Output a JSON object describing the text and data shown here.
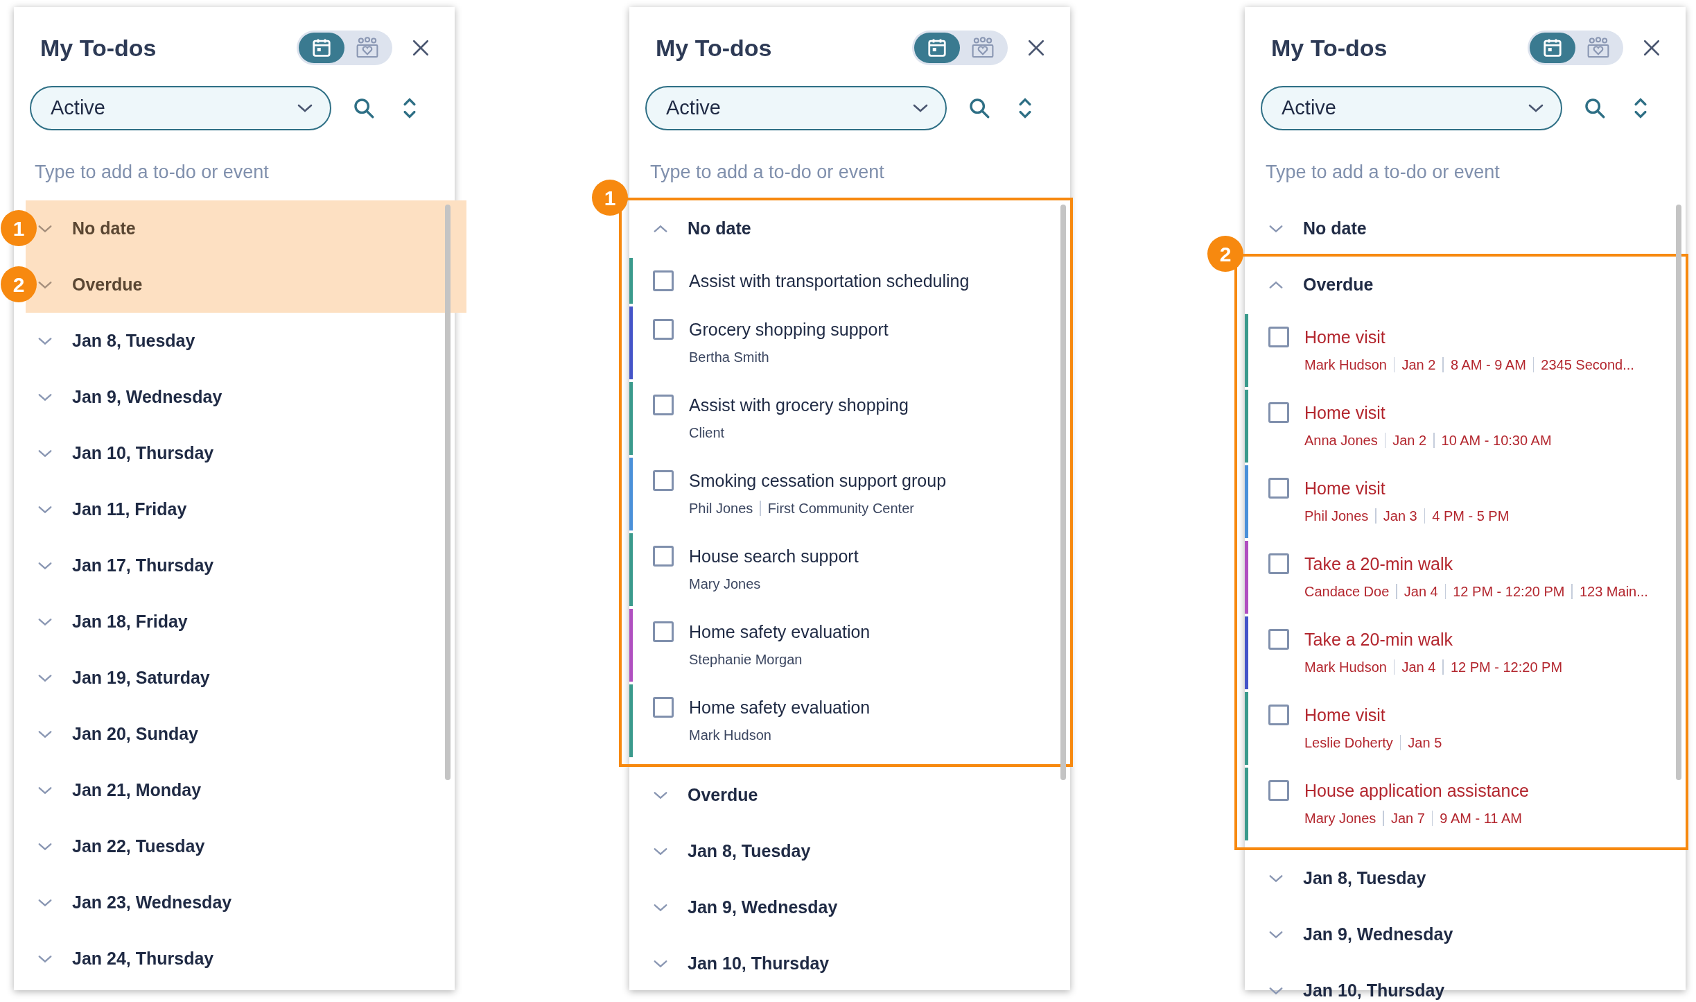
{
  "panels": [
    {
      "title": "My To-dos",
      "view_toggle": [
        {
          "kind": "calendar",
          "selected": true
        },
        {
          "kind": "people",
          "selected": false
        }
      ],
      "filter": "Active",
      "placeholder": "Type to add a to-do or event",
      "sections": [
        {
          "label": "No date",
          "expanded": false,
          "callout": {
            "kind": "fill",
            "badge": "1"
          }
        },
        {
          "label": "Overdue",
          "expanded": false,
          "callout": {
            "kind": "fill",
            "badge": "2"
          }
        },
        {
          "label": "Jan 8, Tuesday",
          "expanded": false
        },
        {
          "label": "Jan 9, Wednesday",
          "expanded": false
        },
        {
          "label": "Jan 10, Thursday",
          "expanded": false
        },
        {
          "label": "Jan 11, Friday",
          "expanded": false
        },
        {
          "label": "Jan 17, Thursday",
          "expanded": false
        },
        {
          "label": "Jan 18, Friday",
          "expanded": false
        },
        {
          "label": "Jan 19, Saturday",
          "expanded": false
        },
        {
          "label": "Jan 20, Sunday",
          "expanded": false
        },
        {
          "label": "Jan 21, Monday",
          "expanded": false
        },
        {
          "label": "Jan 22, Tuesday",
          "expanded": false
        },
        {
          "label": "Jan 23, Wednesday",
          "expanded": false
        },
        {
          "label": "Jan 24, Thursday",
          "expanded": false
        }
      ]
    },
    {
      "title": "My To-dos",
      "view_toggle": [
        {
          "kind": "calendar",
          "selected": true
        },
        {
          "kind": "people",
          "selected": false
        }
      ],
      "filter": "Active",
      "placeholder": "Type to add a to-do or event",
      "sections": [
        {
          "label": "No date",
          "expanded": true,
          "callout": {
            "kind": "outline",
            "badge": "1"
          },
          "items": [
            {
              "title": "Assist with transportation scheduling",
              "checked": false,
              "overdue": false,
              "color": "#3a9a8c"
            },
            {
              "title": "Grocery shopping support",
              "details": [
                "Bertha Smith"
              ],
              "checked": false,
              "overdue": false,
              "color": "#4454c8"
            },
            {
              "title": "Assist with grocery shopping",
              "details": [
                "Client"
              ],
              "checked": false,
              "overdue": false,
              "color": "#3a9a8c"
            },
            {
              "title": "Smoking cessation support group",
              "details": [
                "Phil Jones",
                "First Community Center"
              ],
              "checked": false,
              "overdue": false,
              "color": "#4a90d9"
            },
            {
              "title": "House search support",
              "details": [
                "Mary Jones"
              ],
              "checked": false,
              "overdue": false,
              "color": "#3a9a8c"
            },
            {
              "title": "Home safety evaluation",
              "details": [
                "Stephanie Morgan"
              ],
              "checked": false,
              "overdue": false,
              "color": "#b04fc0"
            },
            {
              "title": "Home safety evaluation",
              "details": [
                "Mark Hudson"
              ],
              "checked": false,
              "overdue": false,
              "color": "#3a9a8c"
            }
          ]
        },
        {
          "label": "Overdue",
          "expanded": false
        },
        {
          "label": "Jan 8, Tuesday",
          "expanded": false
        },
        {
          "label": "Jan 9, Wednesday",
          "expanded": false
        },
        {
          "label": "Jan 10, Thursday",
          "expanded": false
        }
      ]
    },
    {
      "title": "My To-dos",
      "view_toggle": [
        {
          "kind": "calendar",
          "selected": true
        },
        {
          "kind": "people",
          "selected": false
        }
      ],
      "filter": "Active",
      "placeholder": "Type to add a to-do or event",
      "sections": [
        {
          "label": "No date",
          "expanded": false
        },
        {
          "label": "Overdue",
          "expanded": true,
          "callout": {
            "kind": "outline",
            "badge": "2"
          },
          "items": [
            {
              "title": "Home visit",
              "details": [
                "Mark Hudson",
                "Jan 2",
                "8 AM - 9 AM",
                "2345 Second..."
              ],
              "checked": false,
              "overdue": true,
              "color": "#3a9a8c"
            },
            {
              "title": "Home visit",
              "details": [
                "Anna Jones",
                "Jan 2",
                "10 AM - 10:30 AM"
              ],
              "checked": false,
              "overdue": true,
              "color": "#3a9a8c"
            },
            {
              "title": "Home visit",
              "details": [
                "Phil Jones",
                "Jan 3",
                "4 PM - 5 PM"
              ],
              "checked": false,
              "overdue": true,
              "color": "#4a90d9"
            },
            {
              "title": "Take a 20-min walk",
              "details": [
                "Candace Doe",
                "Jan 4",
                "12 PM - 12:20 PM",
                "123 Main..."
              ],
              "checked": false,
              "overdue": true,
              "color": "#b04fc0"
            },
            {
              "title": "Take a 20-min walk",
              "details": [
                "Mark Hudson",
                "Jan 4",
                "12 PM - 12:20 PM"
              ],
              "checked": false,
              "overdue": true,
              "color": "#4454c8"
            },
            {
              "title": "Home visit",
              "details": [
                "Leslie Doherty",
                "Jan 5"
              ],
              "checked": false,
              "overdue": true,
              "color": "#3a9a8c"
            },
            {
              "title": "House application assistance",
              "details": [
                "Mary Jones",
                "Jan 7",
                "9 AM - 11 AM"
              ],
              "checked": false,
              "overdue": true,
              "color": "#3a9a8c"
            }
          ]
        },
        {
          "label": "Jan 8, Tuesday",
          "expanded": false
        },
        {
          "label": "Jan 9, Wednesday",
          "expanded": false
        },
        {
          "label": "Jan 10, Thursday",
          "expanded": false
        }
      ]
    }
  ]
}
